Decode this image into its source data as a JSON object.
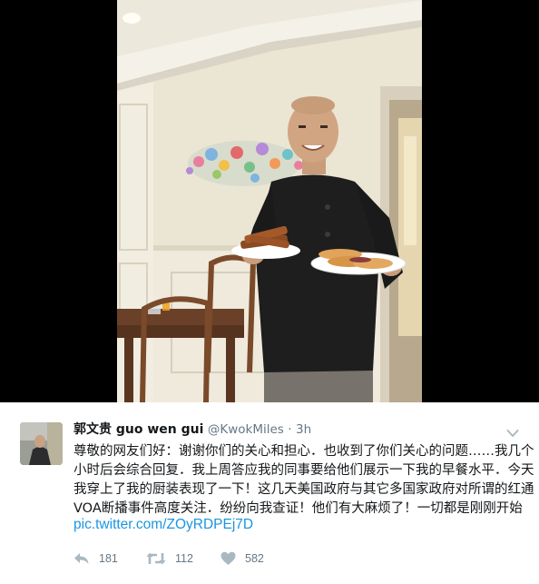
{
  "tweet": {
    "display_name": "郭文贵 guo wen gui",
    "handle": "@KwokMiles",
    "separator": "·",
    "time": "3h",
    "text_lines": [
      "尊敬的网友们好：谢谢你们的关心和担心．也收到了你们关心的问题……我几个",
      "小时后会综合回复．我上周答应我的同事要给他们展示一下我的早餐水平．今天",
      "我穿上了我的厨装表现了一下！这几天美国政府与其它多国家政府对所谓的红通",
      "VOA断播事件高度关注．纷纷向我查证！他们有大麻烦了！一切都是刚刚开始"
    ],
    "link": "pic.twitter.com/ZOyRDPEj7D",
    "actions": {
      "reply_count": "181",
      "retweet_count": "112",
      "like_count": "582"
    }
  },
  "icons": {
    "reply": "reply-icon",
    "retweet": "retweet-icon",
    "like": "heart-icon",
    "more": "chevron-down-icon"
  },
  "colors": {
    "link": "#1b95e0",
    "secondary_text": "#657786",
    "icon": "#aab8c2",
    "media_background": "#000000"
  }
}
